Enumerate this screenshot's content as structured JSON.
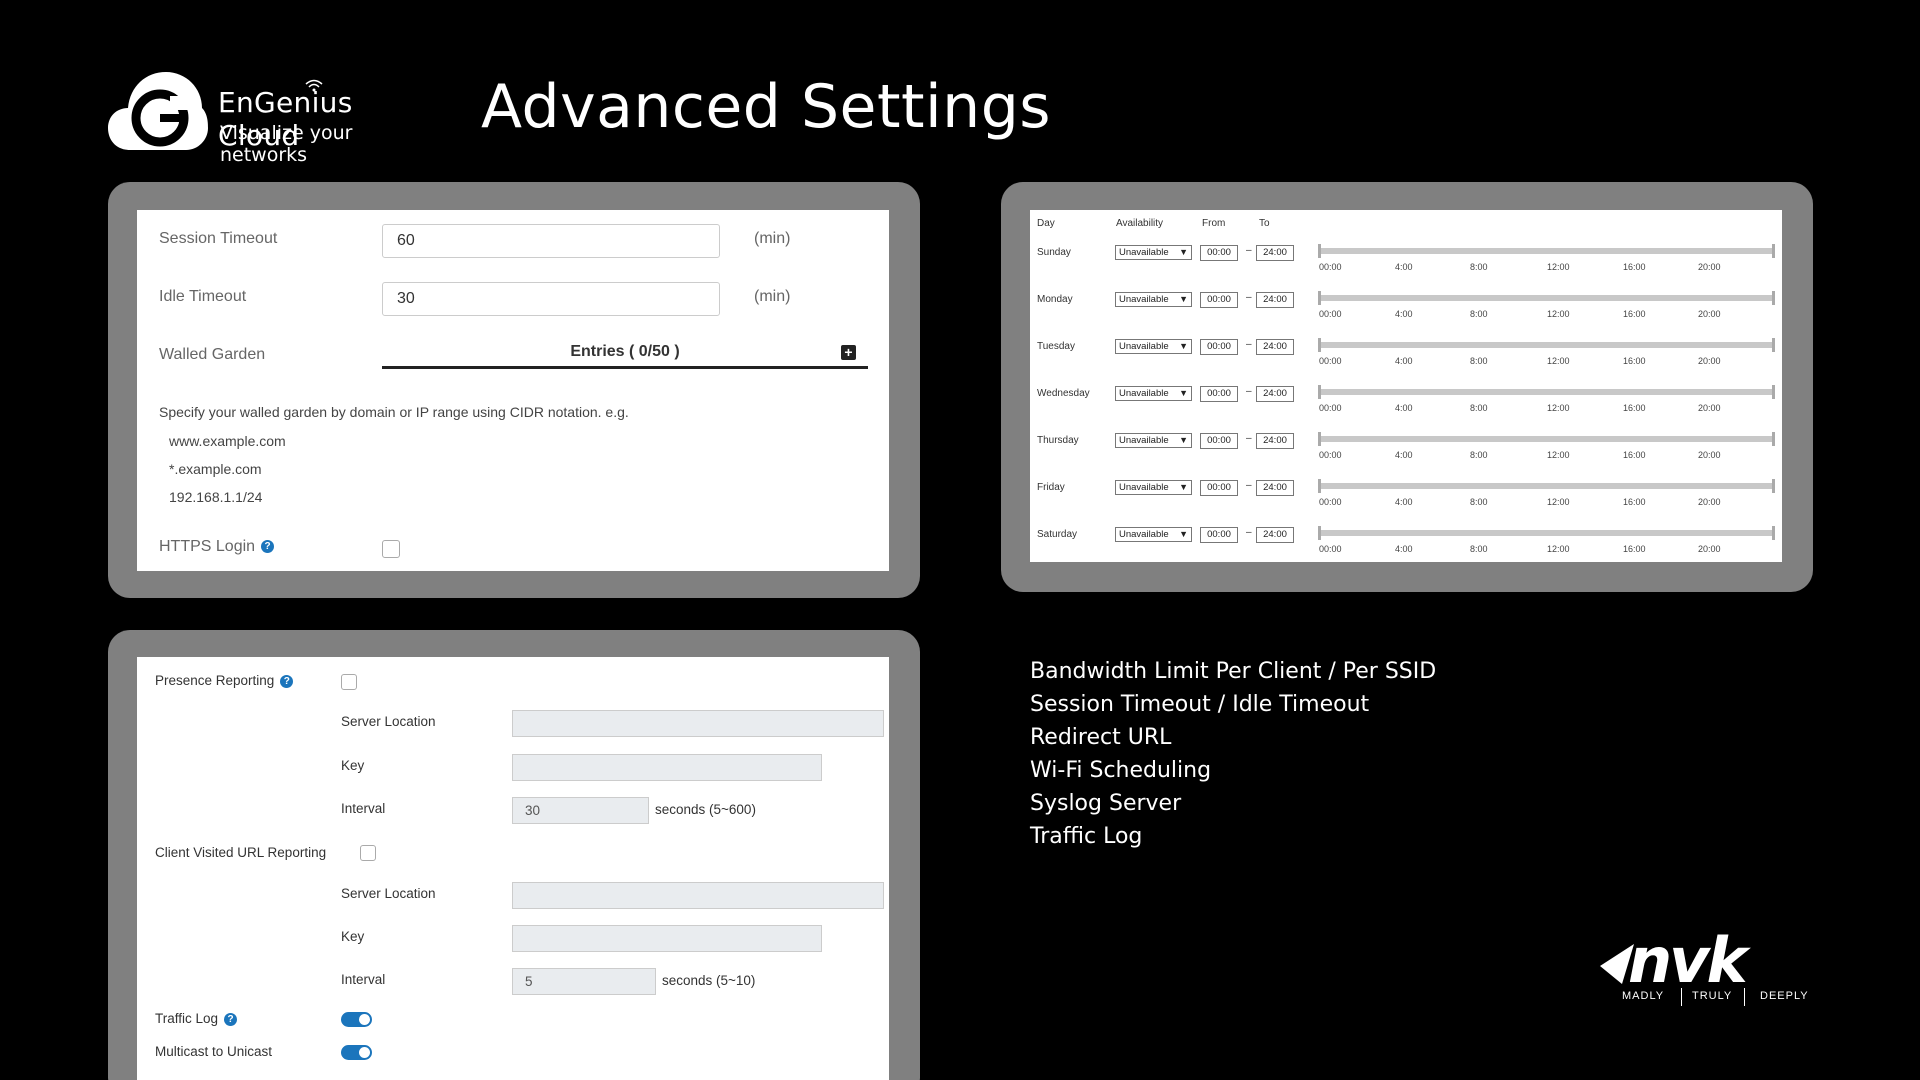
{
  "header": {
    "brand_name": "EnGenius Cloud",
    "brand_tagline": "Visualize your networks",
    "logo_letter": "G",
    "title": "Advanced Settings"
  },
  "session_panel": {
    "session_timeout": {
      "label": "Session Timeout",
      "value": "60",
      "unit": "(min)"
    },
    "idle_timeout": {
      "label": "Idle Timeout",
      "value": "30",
      "unit": "(min)"
    },
    "walled_garden": {
      "label": "Walled Garden",
      "entries": "Entries ( 0/50 )",
      "add_icon": "plus-square-icon"
    },
    "description": "Specify your walled garden by domain or IP range using CIDR notation. e.g.",
    "examples": [
      "www.example.com",
      "*.example.com",
      "192.168.1.1/24"
    ],
    "https_login": {
      "label": "HTTPS Login",
      "checked": false
    }
  },
  "schedule_panel": {
    "headers": {
      "day": "Day",
      "availability": "Availability",
      "from": "From",
      "to": "To"
    },
    "dash": "–",
    "days": [
      {
        "name": "Sunday",
        "availability": "Unavailable",
        "from": "00:00",
        "to": "24:00"
      },
      {
        "name": "Monday",
        "availability": "Unavailable",
        "from": "00:00",
        "to": "24:00"
      },
      {
        "name": "Tuesday",
        "availability": "Unavailable",
        "from": "00:00",
        "to": "24:00"
      },
      {
        "name": "Wednesday",
        "availability": "Unavailable",
        "from": "00:00",
        "to": "24:00"
      },
      {
        "name": "Thursday",
        "availability": "Unavailable",
        "from": "00:00",
        "to": "24:00"
      },
      {
        "name": "Friday",
        "availability": "Unavailable",
        "from": "00:00",
        "to": "24:00"
      },
      {
        "name": "Saturday",
        "availability": "Unavailable",
        "from": "00:00",
        "to": "24:00"
      }
    ],
    "ticks": [
      "00:00",
      "4:00",
      "8:00",
      "12:00",
      "16:00",
      "20:00"
    ]
  },
  "reporting_panel": {
    "presence": {
      "label": "Presence Reporting",
      "checked": false,
      "server_location": {
        "label": "Server Location",
        "value": ""
      },
      "key": {
        "label": "Key",
        "value": ""
      },
      "interval": {
        "label": "Interval",
        "value": "30",
        "unit": "seconds (5~600)"
      }
    },
    "url_reporting": {
      "label": "Client Visited URL Reporting",
      "checked": false,
      "server_location": {
        "label": "Server Location",
        "value": ""
      },
      "key": {
        "label": "Key",
        "value": ""
      },
      "interval": {
        "label": "Interval",
        "value": "5",
        "unit": "seconds (5~10)"
      }
    },
    "traffic_log": {
      "label": "Traffic Log",
      "enabled": true
    },
    "multicast": {
      "label": "Multicast to Unicast",
      "enabled": true
    }
  },
  "features": [
    "Bandwidth Limit Per Client / Per SSID",
    "Session Timeout / Idle Timeout",
    "Redirect URL",
    "Wi-Fi Scheduling",
    "Syslog Server",
    "Traffic Log"
  ],
  "footer_logo": {
    "word": "nvk",
    "tags": [
      "MADLY",
      "TRULY",
      "DEEPLY"
    ]
  },
  "colors": {
    "accent": "#1b75bc",
    "frame": "#808080",
    "background": "#000000"
  }
}
